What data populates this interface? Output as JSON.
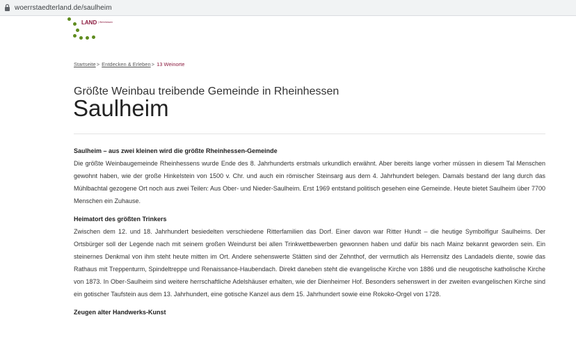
{
  "browser": {
    "url": "woerrstaedterland.de/saulheim"
  },
  "logo": {
    "word": "LAND",
    "sub": "| Weinhessen"
  },
  "breadcrumb": {
    "home": "Startseite",
    "section": "Entdecken & Erleben",
    "current": "13 Weinorte",
    "separator": ">"
  },
  "page": {
    "subtitle": "Größte Weinbau treibende Gemeinde in Rheinhessen",
    "title": "Saulheim"
  },
  "sections": [
    {
      "heading": "Saulheim – aus zwei kleinen wird die größte Rheinhessen-Gemeinde",
      "text": "Die größte Weinbaugemeinde Rheinhessens wurde Ende des 8. Jahrhunderts erstmals urkundlich erwähnt. Aber bereits lange vorher müssen in diesem Tal Menschen gewohnt haben, wie der große Hinkelstein von 1500 v. Chr. und auch ein römischer Steinsarg aus dem 4. Jahrhundert belegen. Damals bestand der lang durch das Mühlbachtal gezogene Ort noch aus zwei Teilen: Aus Ober- und Nieder-Saulheim. Erst 1969 entstand politisch gesehen eine Gemeinde. Heute bietet Saulheim über 7700 Menschen ein Zuhause."
    },
    {
      "heading": "Heimatort des größten Trinkers",
      "text": "Zwischen dem 12. und 18. Jahrhundert besiedelten verschiedene Ritterfamilien das Dorf. Einer davon war Ritter Hundt – die heutige Symbolfigur Saulheims. Der Ortsbürger soll der Legende nach mit seinem großen Weindurst bei allen Trinkwettbewerben gewonnen haben und dafür bis nach Mainz bekannt geworden sein. Ein steinernes Denkmal von ihm steht heute mitten im Ort. Andere sehenswerte Stätten sind der Zehnthof, der vermutlich als Herrensitz des Landadels diente, sowie das Rathaus mit Treppenturm, Spindeltreppe und Renaissance-Haubendach. Direkt daneben steht die evangelische Kirche von 1886 und die neugotische katholische Kirche von 1873. In Ober-Saulheim sind weitere herrschaftliche Adelshäuser erhalten, wie der Dienheimer Hof. Besonders sehenswert in der zweiten evangelischen Kirche sind ein gotischer Taufstein aus dem 13. Jahrhundert, eine gotische Kanzel aus dem 15. Jahrhundert sowie eine Rokoko-Orgel von 1728."
    },
    {
      "heading": "Zeugen alter Handwerks-Kunst",
      "text": ""
    }
  ],
  "colors": {
    "accent": "#8b1a3e",
    "logo_dots": "#5f8c1f"
  },
  "icons": {
    "lock": "lock-icon"
  }
}
